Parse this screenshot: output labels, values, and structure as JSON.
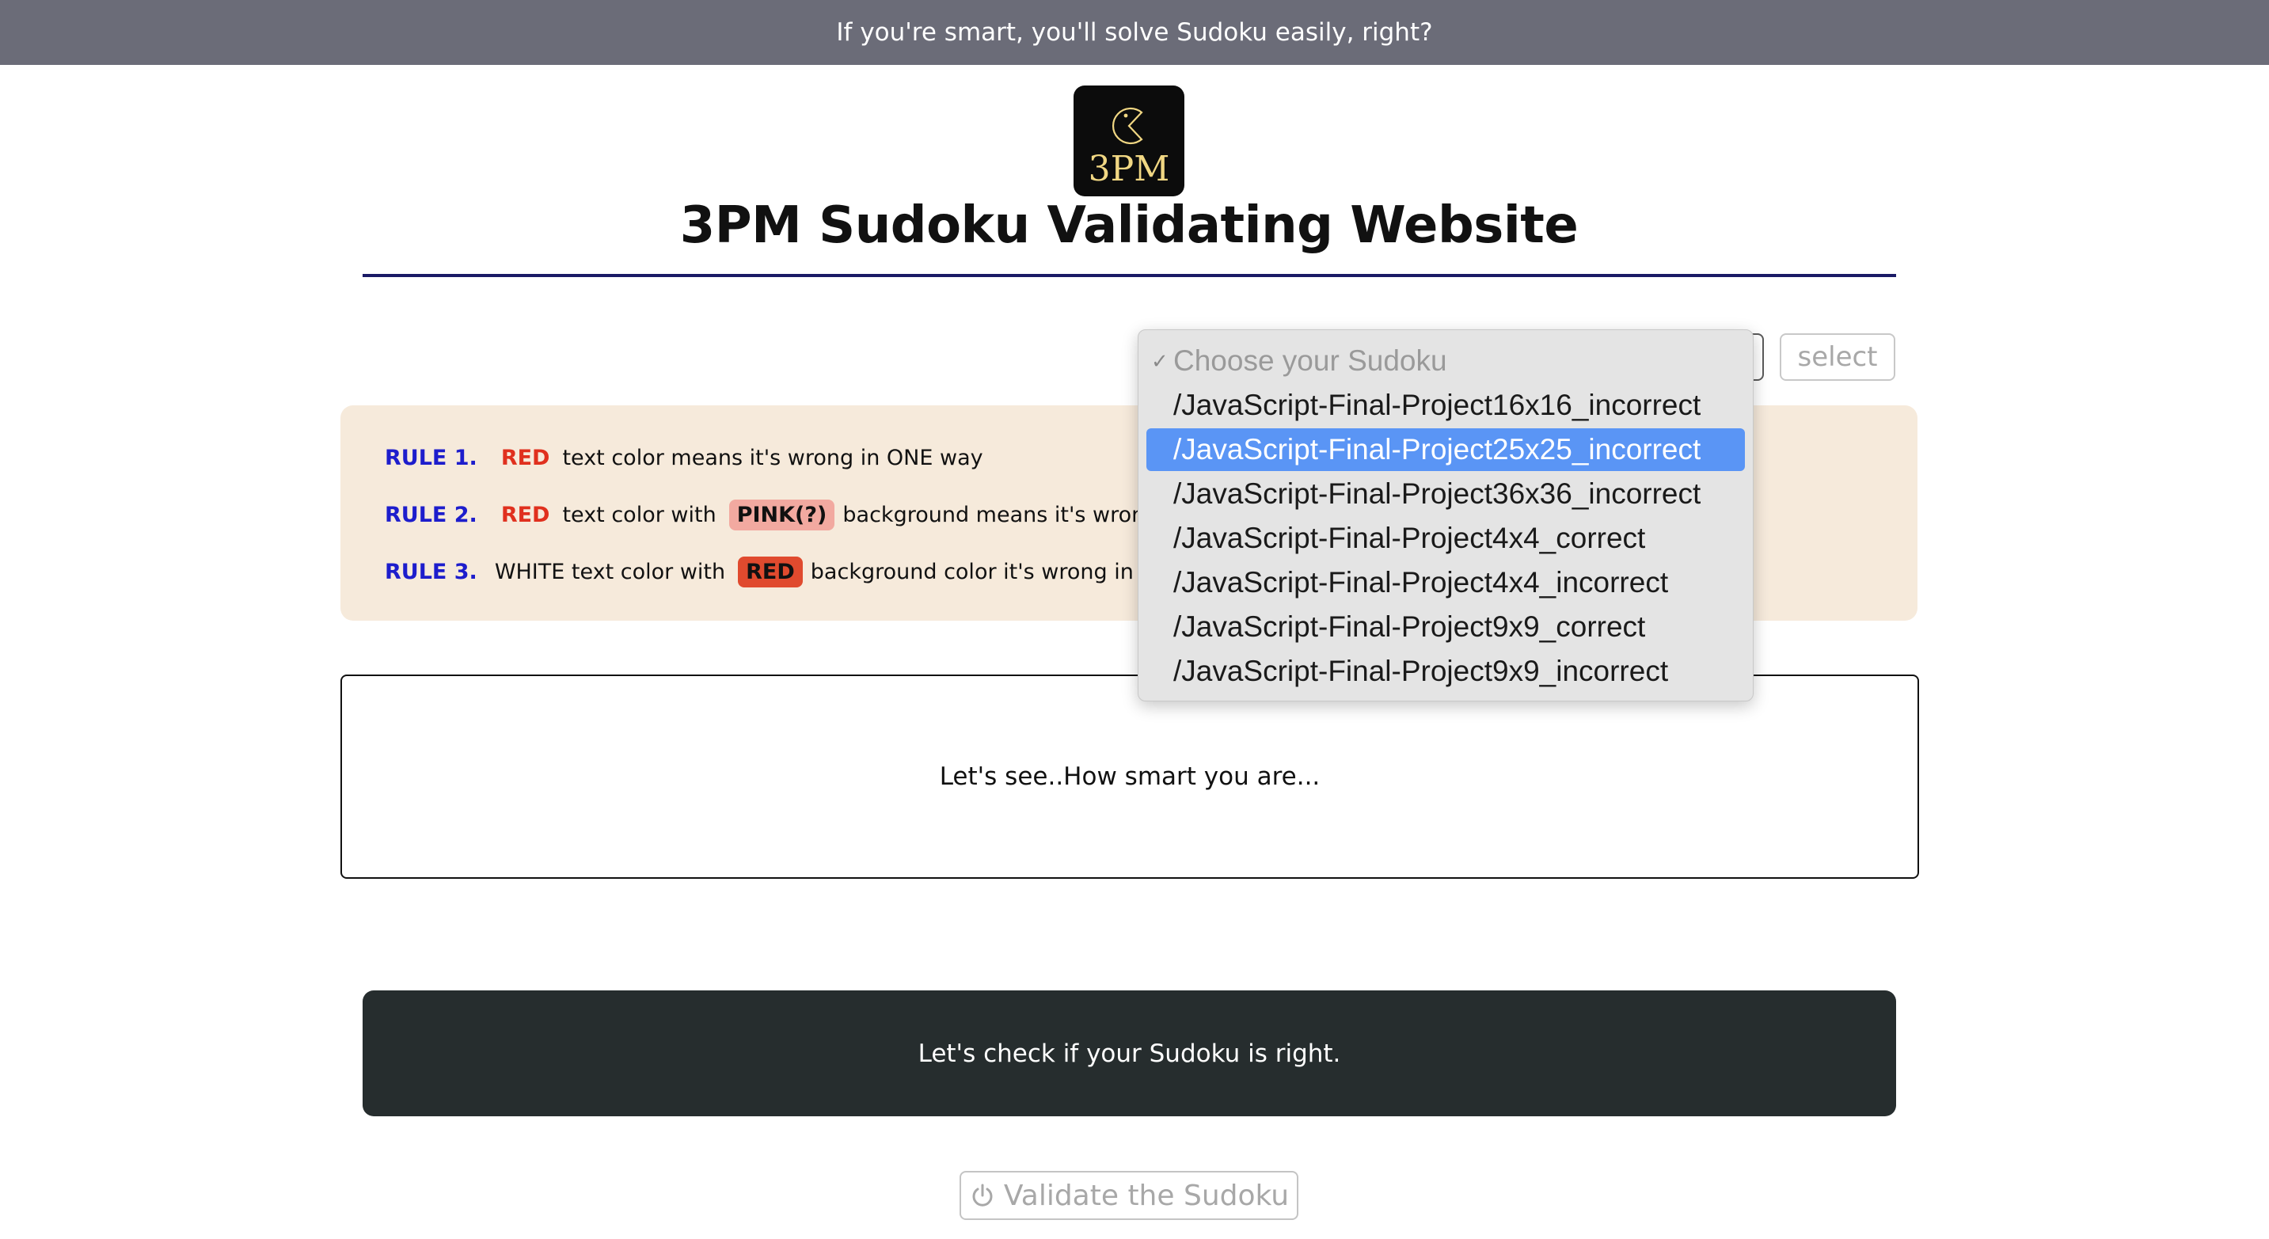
{
  "top_banner": {
    "text": "If you're smart, you'll solve Sudoku easily, right?"
  },
  "logo": {
    "text": "3PM",
    "icon": "pacman-icon",
    "colors": {
      "background": "#0c0c0c",
      "text": "#f1d783"
    }
  },
  "page_title": "3PM Sudoku Validating Website",
  "selector": {
    "button_label": "select",
    "options": [
      {
        "label": "Choose your Sudoku",
        "placeholder": true,
        "checked": true
      },
      {
        "label": "/JavaScript-Final-Project16x16_incorrect"
      },
      {
        "label": "/JavaScript-Final-Project25x25_incorrect",
        "highlighted": true
      },
      {
        "label": "/JavaScript-Final-Project36x36_incorrect"
      },
      {
        "label": "/JavaScript-Final-Project4x4_correct"
      },
      {
        "label": "/JavaScript-Final-Project4x4_incorrect"
      },
      {
        "label": "/JavaScript-Final-Project9x9_correct"
      },
      {
        "label": "/JavaScript-Final-Project9x9_incorrect"
      }
    ],
    "highlight_color": "#5a95f5"
  },
  "rules": [
    {
      "num": "RULE 1.",
      "red_word": "RED",
      "text": "text color means it's wrong in ONE way"
    },
    {
      "num": "RULE 2.",
      "red_word": "RED",
      "text_before": "text color with",
      "chip": "PINK(?)",
      "text_after": "background means it's wrong in T"
    },
    {
      "num": "RULE 3.",
      "text_before": "WHITE text color with",
      "chip": "RED",
      "text_after": "background color it's wrong in ALL"
    }
  ],
  "message": "Let's see..How smart you are...",
  "check_banner": "Let's check if your Sudoku is right.",
  "validate_button": {
    "label": "Validate the Sudoku",
    "icon": "power-icon"
  },
  "colors": {
    "top_banner_bg": "#6b6c78",
    "rules_bg": "#f6eadb",
    "rule_number": "#1d1dcc",
    "red": "#e0301e",
    "pink_chip": "#f2a9a0",
    "red_chip": "#e04a2e",
    "check_banner_bg": "#262d2e",
    "divider": "#1a1a66"
  }
}
